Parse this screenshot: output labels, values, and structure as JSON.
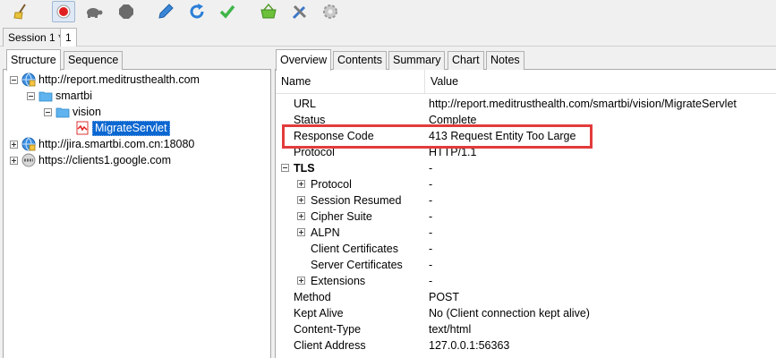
{
  "toolbar": {
    "icons": [
      "broom-icon",
      "record-icon",
      "turtle-icon",
      "stop-icon",
      "pen-icon",
      "refresh-icon",
      "check-icon",
      "basket-icon",
      "tools-icon",
      "gear-icon"
    ]
  },
  "sessions": {
    "tabs": [
      {
        "label": "Session 1 *"
      },
      {
        "label": "1"
      }
    ]
  },
  "left_tabs": [
    {
      "label": "Structure"
    },
    {
      "label": "Sequence"
    }
  ],
  "tree": [
    {
      "label": "http://report.meditrusthealth.com",
      "icon": "globe-lock-icon",
      "expander": "minus"
    },
    {
      "label": "smartbi",
      "icon": "folder-icon",
      "expander": "minus"
    },
    {
      "label": "vision",
      "icon": "folder-icon",
      "expander": "minus"
    },
    {
      "label": "MigrateServlet",
      "icon": "request-error-icon",
      "expander": ""
    },
    {
      "label": "http://jira.smartbi.com.cn:18080",
      "icon": "globe-lock-icon",
      "expander": "plus"
    },
    {
      "label": "https://clients1.google.com",
      "icon": "globe-grey-icon",
      "expander": "plus"
    }
  ],
  "right_tabs": [
    {
      "label": "Overview"
    },
    {
      "label": "Contents"
    },
    {
      "label": "Summary"
    },
    {
      "label": "Chart"
    },
    {
      "label": "Notes"
    }
  ],
  "grid": {
    "col_name": "Name",
    "col_value": "Value",
    "rows": [
      {
        "name": "URL",
        "value": "http://report.meditrusthealth.com/smartbi/vision/MigrateServlet"
      },
      {
        "name": "Status",
        "value": "Complete"
      },
      {
        "name": "Response Code",
        "value": "413 Request Entity Too Large"
      },
      {
        "name": "Protocol",
        "value": "HTTP/1.1"
      },
      {
        "name": "TLS",
        "value": "-"
      },
      {
        "name": "Protocol",
        "value": "-"
      },
      {
        "name": "Session Resumed",
        "value": "-"
      },
      {
        "name": "Cipher Suite",
        "value": "-"
      },
      {
        "name": "ALPN",
        "value": "-"
      },
      {
        "name": "Client Certificates",
        "value": "-"
      },
      {
        "name": "Server Certificates",
        "value": "-"
      },
      {
        "name": "Extensions",
        "value": "-"
      },
      {
        "name": "Method",
        "value": "POST"
      },
      {
        "name": "Kept Alive",
        "value": "No (Client connection kept alive)"
      },
      {
        "name": "Content-Type",
        "value": "text/html"
      },
      {
        "name": "Client Address",
        "value": "127.0.0.1:56363"
      }
    ]
  },
  "colors": {
    "selection": "#0b67d1",
    "highlight_border": "#e23b3b"
  }
}
